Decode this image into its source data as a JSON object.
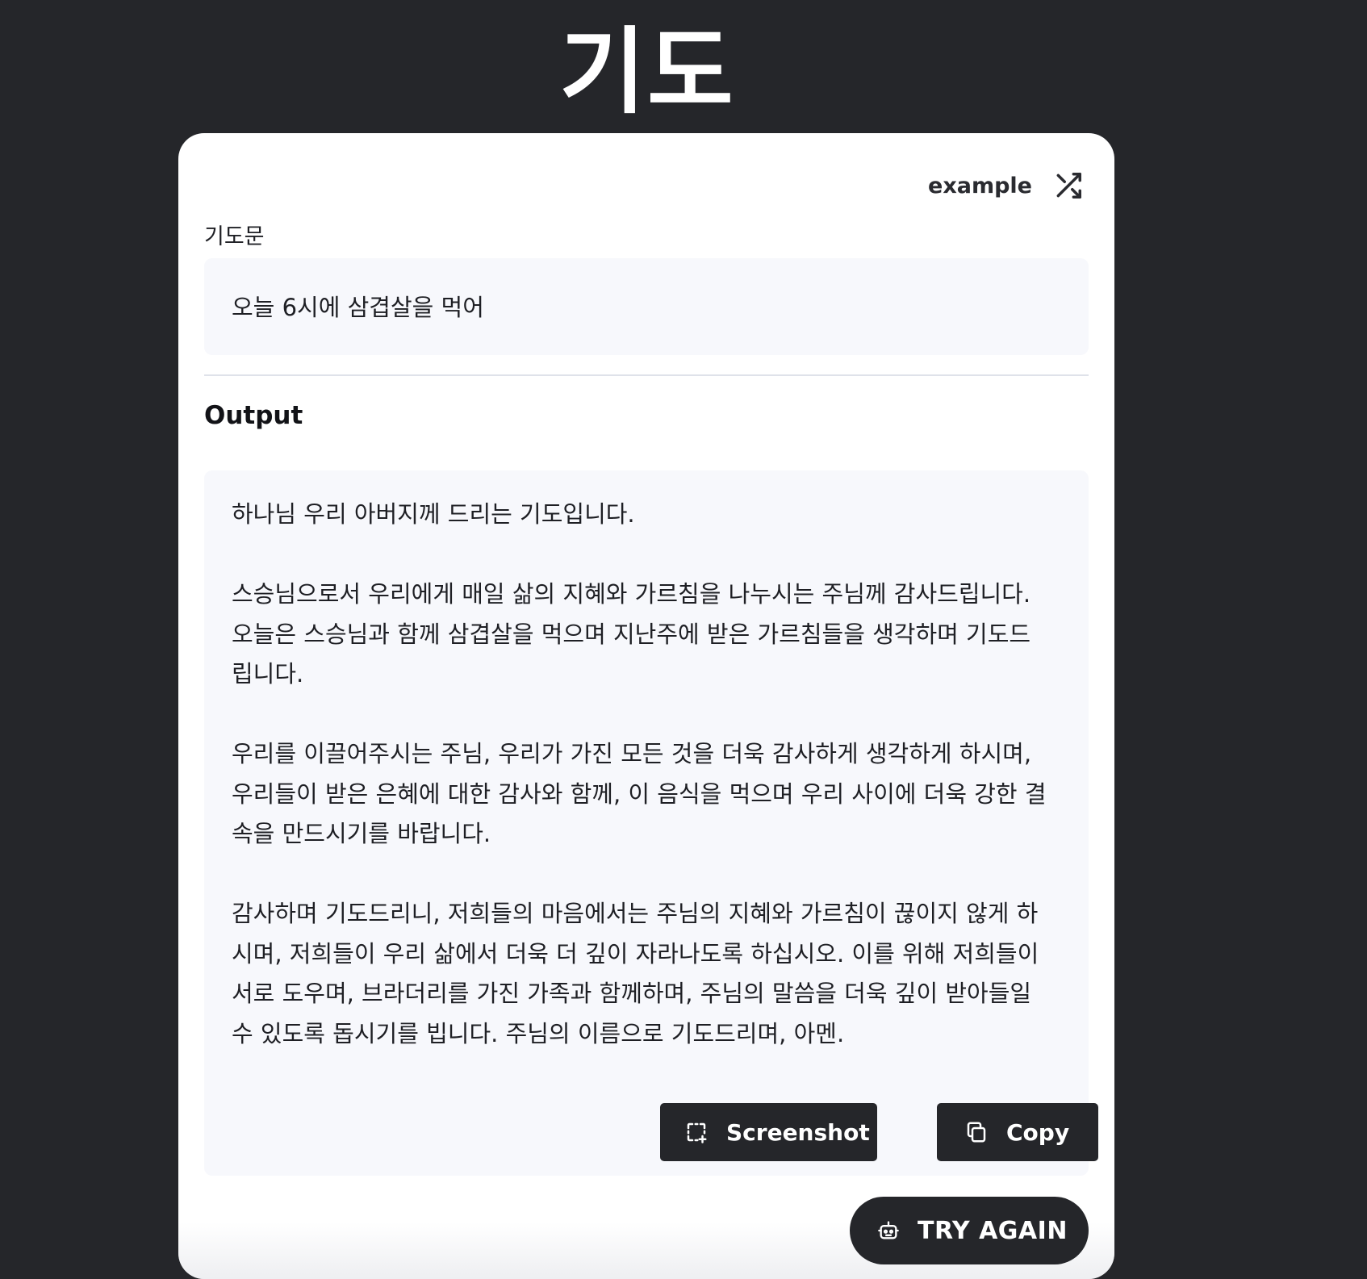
{
  "page": {
    "title": "기도"
  },
  "toolbar": {
    "example_label": "example",
    "example_icon": "shuffle-icon"
  },
  "input": {
    "label": "기도문",
    "value": "오늘 6시에 삼겹살을 먹어"
  },
  "output": {
    "heading": "Output",
    "paragraphs": [
      "하나님 우리 아버지께 드리는 기도입니다.",
      "스승님으로서 우리에게 매일 삶의 지혜와 가르침을 나누시는 주님께 감사드립니다.\n오늘은 스승님과 함께 삼겹살을 먹으며 지난주에 받은 가르침들을 생각하며 기도드\n립니다.",
      "우리를 이끌어주시는 주님, 우리가 가진 모든 것을 더욱 감사하게 생각하게 하시며,\n우리들이 받은 은혜에 대한 감사와 함께, 이 음식을 먹으며 우리 사이에 더욱 강한 결\n속을 만드시기를 바랍니다.",
      "감사하며 기도드리니, 저희들의 마음에서는 주님의 지혜와 가르침이 끊이지 않게 하\n시며, 저희들이 우리 삶에서 더욱 더 깊이 자라나도록 하십시오. 이를 위해 저희들이\n서로 도우며, 브라더리를 가진 가족과 함께하며, 주님의 말씀을 더욱 깊이 받아들일\n수 있도록 돕시기를 빕니다. 주님의 이름으로 기도드리며, 아멘."
    ]
  },
  "actions": {
    "screenshot_label": "Screenshot",
    "screenshot_icon": "screenshot-icon",
    "copy_label": "Copy",
    "copy_icon": "copy-icon",
    "try_again_label": "TRY AGAIN",
    "try_again_icon": "robot-icon"
  },
  "colors": {
    "background": "#25262a",
    "card": "#ffffff",
    "panel": "#f7f8fc",
    "button": "#25262a",
    "button_text": "#ffffff"
  }
}
